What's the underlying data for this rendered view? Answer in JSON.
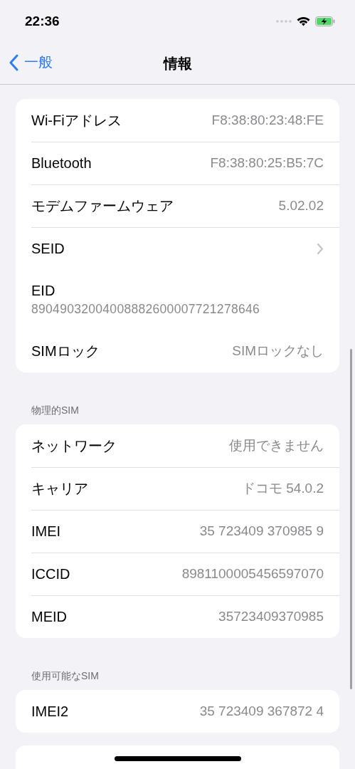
{
  "status_bar": {
    "time": "22:36"
  },
  "nav": {
    "back": "一般",
    "title": "情報"
  },
  "sections": [
    {
      "rows": [
        {
          "kind": "value",
          "label": "Wi-Fiアドレス",
          "value": "F8:38:80:23:48:FE"
        },
        {
          "kind": "value",
          "label": "Bluetooth",
          "value": "F8:38:80:25:B5:7C"
        },
        {
          "kind": "value",
          "label": "モデムファームウェア",
          "value": "5.02.02"
        },
        {
          "kind": "chevron",
          "label": "SEID"
        },
        {
          "kind": "stacked",
          "label": "EID",
          "value": "89049032004008882600007721278646"
        },
        {
          "kind": "value",
          "label": "SIMロック",
          "value": "SIMロックなし"
        }
      ]
    },
    {
      "header": "物理的SIM",
      "rows": [
        {
          "kind": "value",
          "label": "ネットワーク",
          "value": "使用できません"
        },
        {
          "kind": "value",
          "label": "キャリア",
          "value": "ドコモ 54.0.2"
        },
        {
          "kind": "value",
          "label": "IMEI",
          "value": "35 723409 370985 9"
        },
        {
          "kind": "value",
          "label": "ICCID",
          "value": "8981100005456597070"
        },
        {
          "kind": "value",
          "label": "MEID",
          "value": "35723409370985"
        }
      ]
    },
    {
      "header": "使用可能なSIM",
      "rows": [
        {
          "kind": "value",
          "label": "IMEI2",
          "value": "35 723409 367872 4"
        }
      ]
    }
  ]
}
